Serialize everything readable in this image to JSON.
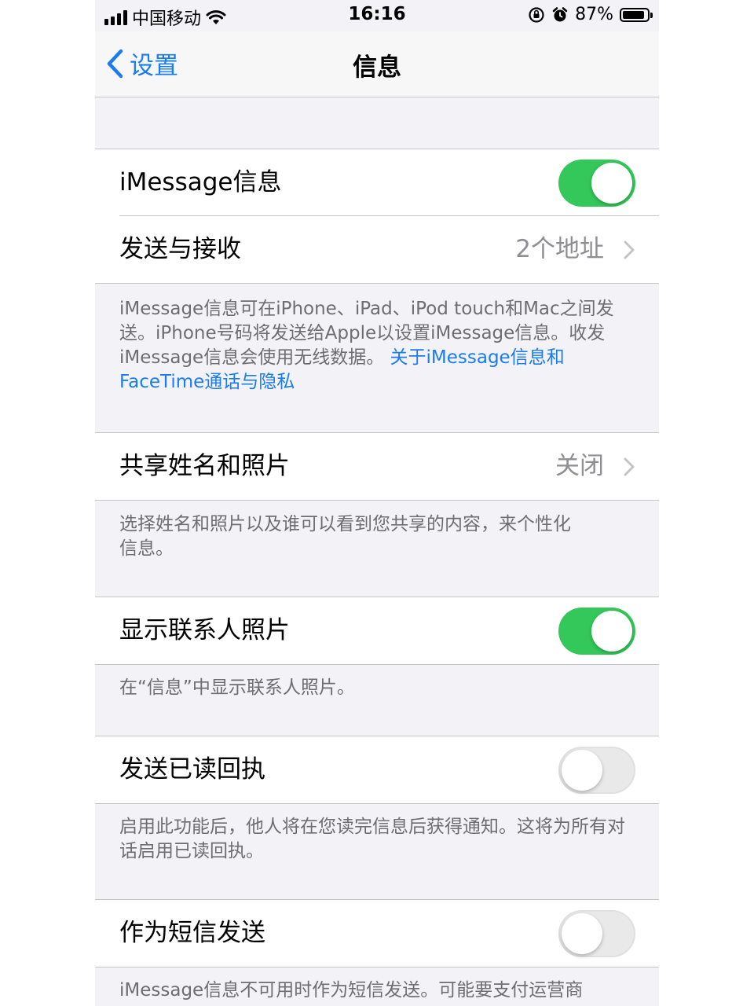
{
  "status_bar": {
    "carrier": "中国移动",
    "time": "16:16",
    "battery": "87%",
    "icons": [
      "signal-icon",
      "wifi-icon",
      "orientation-lock-icon",
      "alarm-icon",
      "battery-icon"
    ]
  },
  "nav": {
    "back_label": "设置",
    "title": "信息"
  },
  "rows": {
    "imessage": {
      "label": "iMessage信息",
      "toggle": true
    },
    "send_receive": {
      "label": "发送与接收",
      "value": "2个地址"
    },
    "share_name": {
      "label": "共享姓名和照片",
      "value": "关闭"
    },
    "contact_photos": {
      "label": "显示联系人照片",
      "toggle": true
    },
    "read_receipts": {
      "label": "发送已读回执",
      "toggle": false
    },
    "send_as_sms": {
      "label": "作为短信发送",
      "toggle": false
    }
  },
  "footers": {
    "imessage_text": "iMessage信息可在iPhone、iPad、iPod touch和Mac之间发送。iPhone号码将发送给Apple以设置iMessage信息。收发iMessage信息会使用无线数据。",
    "imessage_link": "关于iMessage信息和FaceTime通话与隐私",
    "share_name_text": "选择姓名和照片以及谁可以看到您共享的内容，来个性化信息。",
    "contact_photos_text": "在“信息”中显示联系人照片。",
    "read_receipts_text": "启用此功能后，他人将在您读完信息后获得通知。这将为所有对话启用已读回执。",
    "sms_text": "iMessage信息不可用时作为短信发送。可能要支付运营商"
  },
  "colors": {
    "accent": "#1a7cf0",
    "toggle_on": "#34c759",
    "background": "#f2f2f7",
    "secondary_text": "#8e8e93"
  }
}
